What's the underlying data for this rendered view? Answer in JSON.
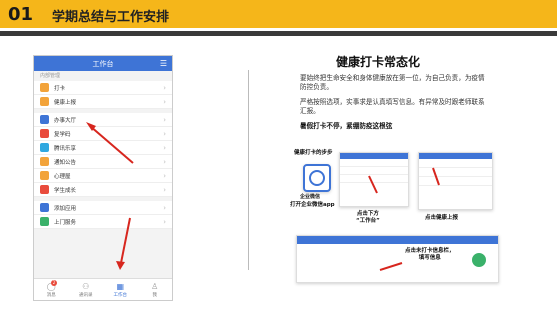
{
  "header": {
    "number": "01",
    "title": "学期总结与工作安排"
  },
  "phone": {
    "title": "工作台",
    "section": "内部管理",
    "items": [
      {
        "label": "打卡",
        "color": "#f2a33a"
      },
      {
        "label": "健康上报",
        "color": "#f2a33a"
      }
    ],
    "items2": [
      {
        "label": "办事大厅",
        "color": "#3e74d6"
      },
      {
        "label": "复学码",
        "color": "#e94b3c"
      },
      {
        "label": "腾讯乐享",
        "color": "#30a8e0"
      },
      {
        "label": "通知公告",
        "color": "#f2a33a"
      },
      {
        "label": "心理屋",
        "color": "#f2a33a"
      },
      {
        "label": "学生成长",
        "color": "#e94b3c"
      }
    ],
    "items3": [
      {
        "label": "添加应用",
        "color": "#3e74d6"
      },
      {
        "label": "上门服务",
        "color": "#3ab16a"
      }
    ],
    "tabs": [
      {
        "label": "消息",
        "icon": "chat-icon",
        "badge": "2"
      },
      {
        "label": "通讯录",
        "icon": "contacts-icon"
      },
      {
        "label": "工作台",
        "icon": "grid-icon",
        "active": true
      },
      {
        "label": "我",
        "icon": "person-icon"
      }
    ]
  },
  "right": {
    "title": "健康打卡常态化",
    "p1": "要始终把生命安全和身体健康放在第一位，为自己负责，为疫情防控负责。",
    "p2": "严格按照选项，实事求是认真填写信息。有异常及时跟老师联系汇报。",
    "p3": "暑假打卡不停，紧绷防疫这根弦",
    "cap_step1": "健康打卡的步步",
    "cap_app": "打开企业微信app",
    "app_label": "企业微信",
    "cap_bottom_l1": "点击下方",
    "cap_bottom_l2": "“工作台”",
    "cap_health": "点击健康上报",
    "cap_fill_l1": "点击未打卡信息栏，",
    "cap_fill_l2": "填写信息"
  },
  "colors": {
    "header": "#f5b61a",
    "blue": "#3e74d6",
    "arrow": "#d7261e"
  }
}
